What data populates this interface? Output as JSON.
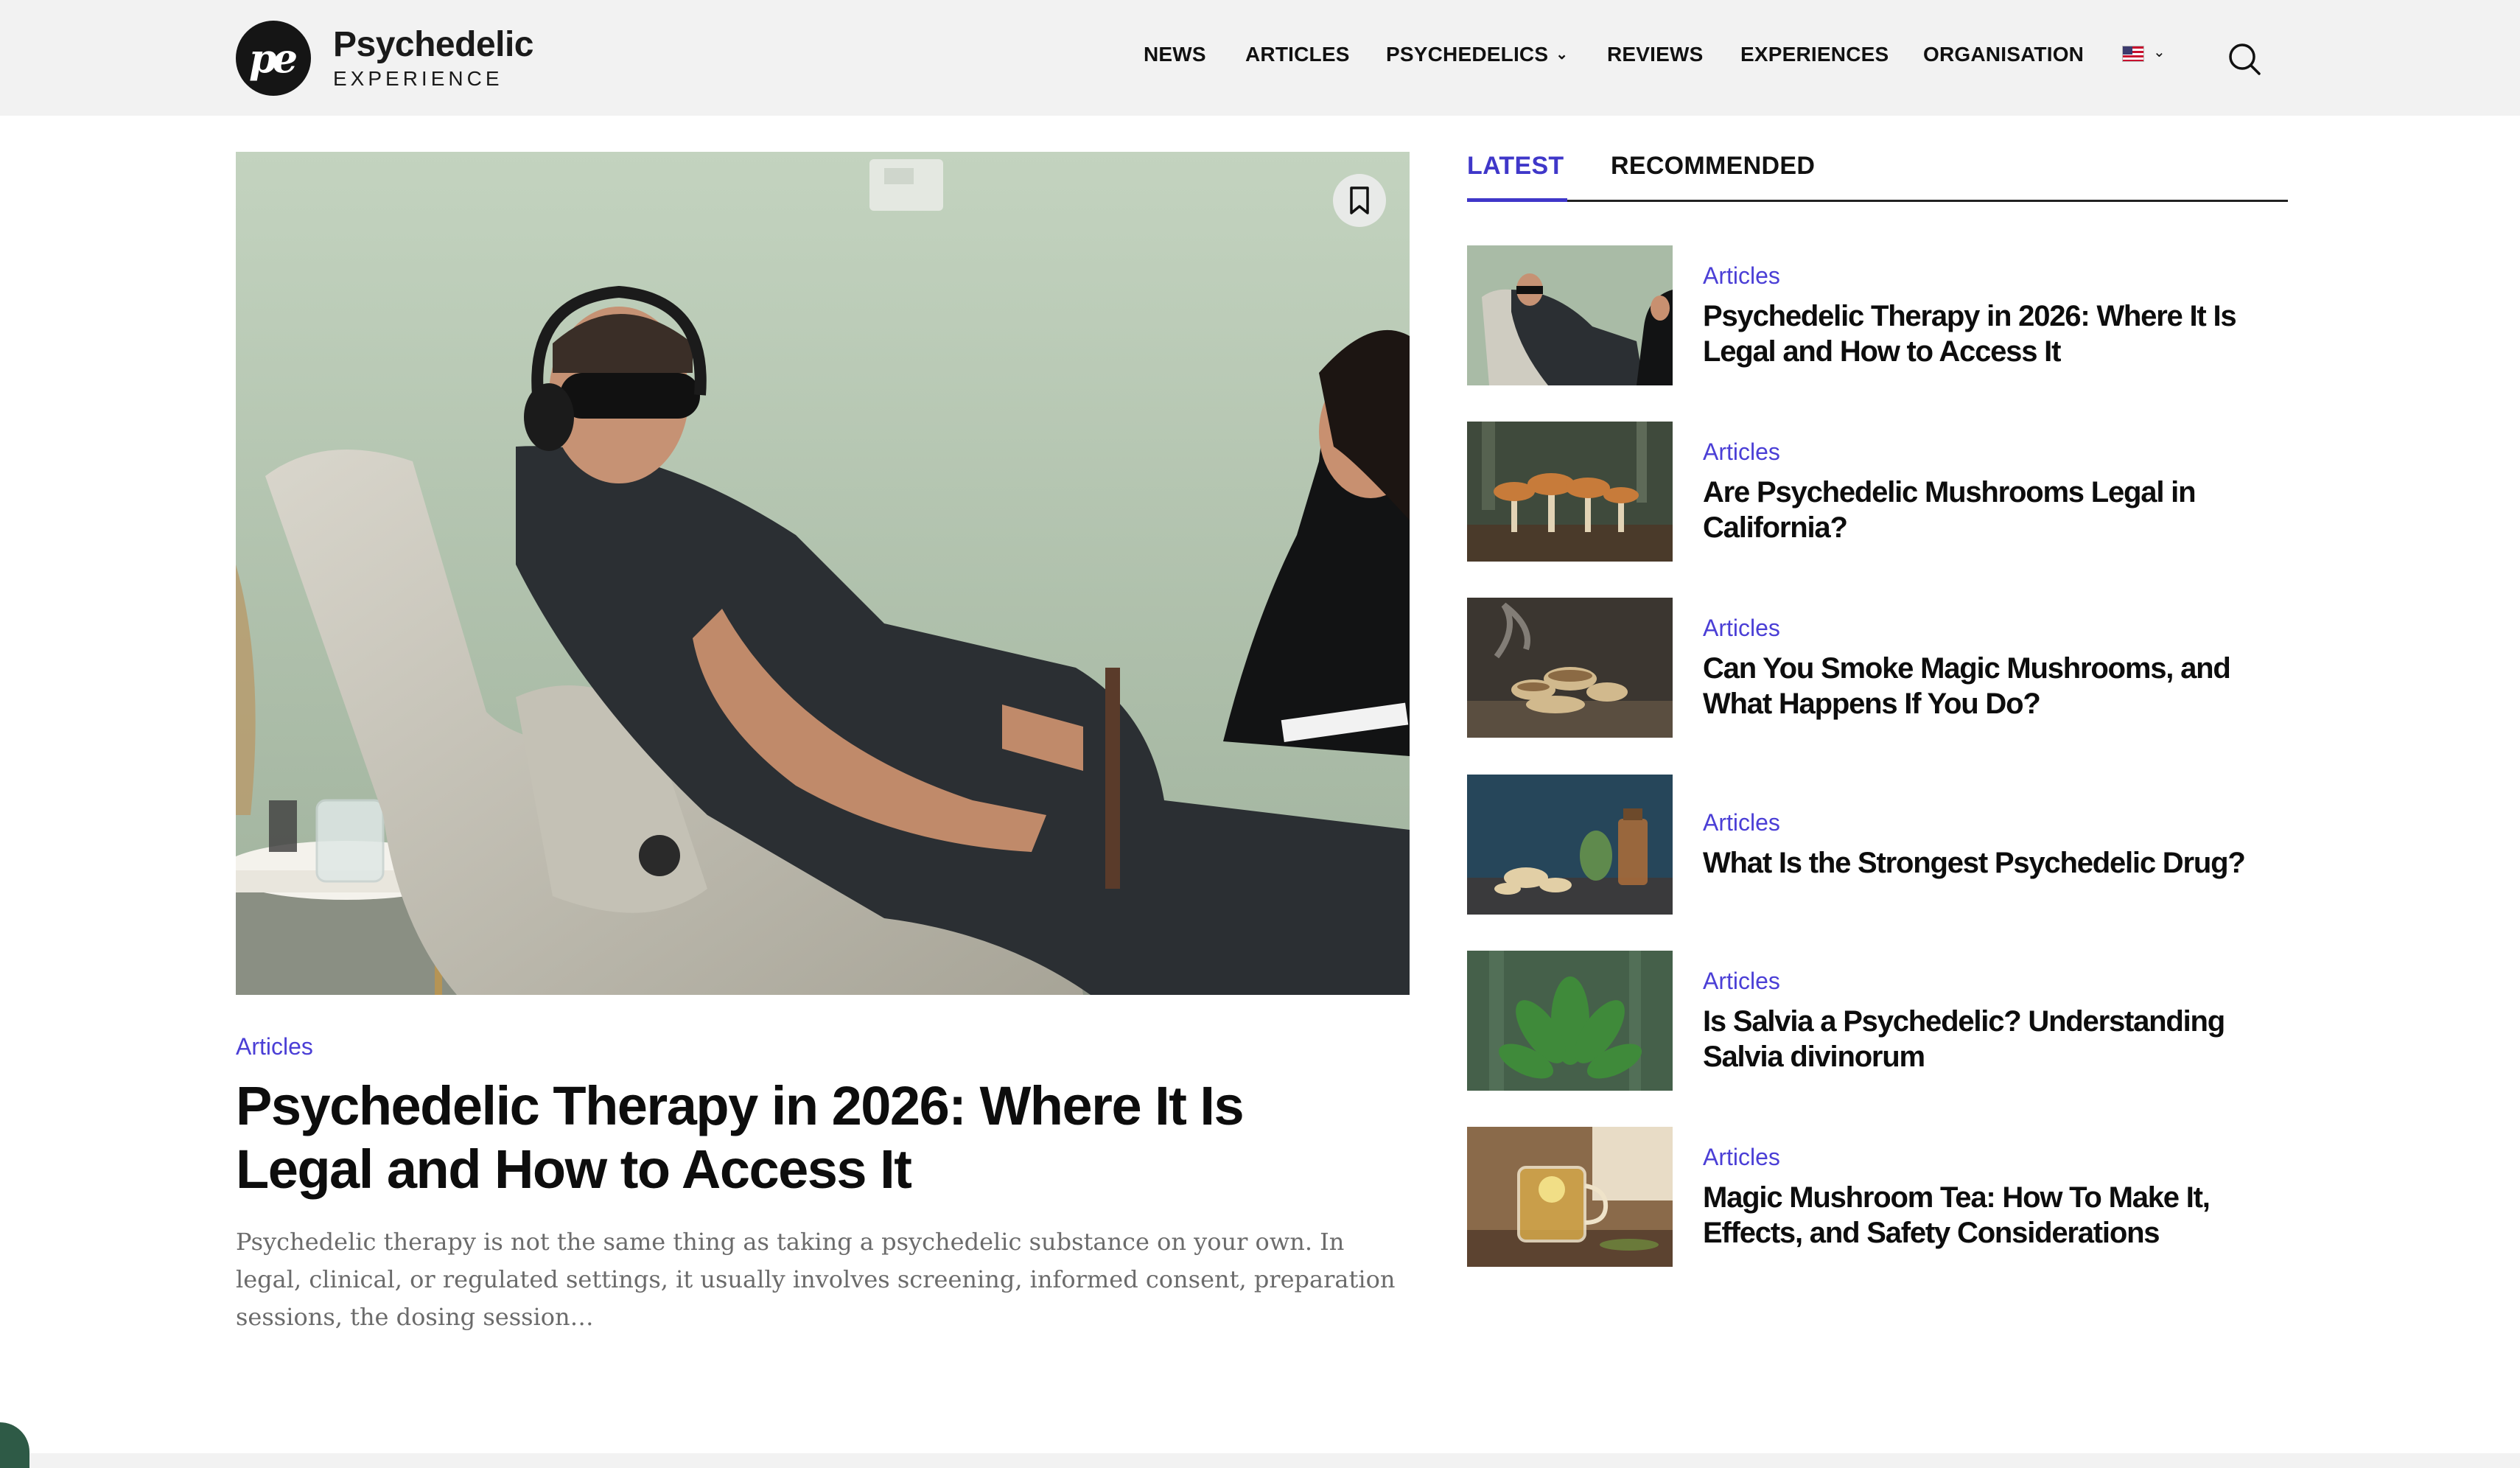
{
  "brand": {
    "mark": "pe",
    "name": "Psychedelic",
    "sub": "EXPERIENCE"
  },
  "nav": {
    "items": [
      "NEWS",
      "ARTICLES",
      "PSYCHEDELICS",
      "REVIEWS",
      "EXPERIENCES",
      "ORGANISATION"
    ],
    "language_icon": "us-flag-icon"
  },
  "hero": {
    "category": "Articles",
    "title": "Psychedelic Therapy in 2026: Where It Is Legal and How to Access It",
    "excerpt": "Psychedelic therapy is not the same thing as taking a psychedelic substance on your own.  In legal, clinical, or regulated settings, it usually involves screening, informed consent, preparation sessions, the dosing session…"
  },
  "sidebar": {
    "tabs": [
      "LATEST",
      "RECOMMENDED"
    ],
    "posts": [
      {
        "category": "Articles",
        "title": "Psychedelic Therapy in 2026: Where It Is Legal and How to Access It"
      },
      {
        "category": "Articles",
        "title": "Are Psychedelic Mushrooms Legal in California?"
      },
      {
        "category": "Articles",
        "title": "Can You Smoke Magic Mushrooms, and What Happens If You Do?"
      },
      {
        "category": "Articles",
        "title": "What Is the Strongest Psychedelic Drug?"
      },
      {
        "category": "Articles",
        "title": "Is Salvia a Psychedelic? Understanding Salvia divinorum"
      },
      {
        "category": "Articles",
        "title": "Magic Mushroom Tea: How To Make It, Effects, and Safety Considerations"
      }
    ]
  },
  "colors": {
    "accent": "#3f37c9",
    "category": "#4b3fd6",
    "header_bg": "#f2f2f2"
  }
}
